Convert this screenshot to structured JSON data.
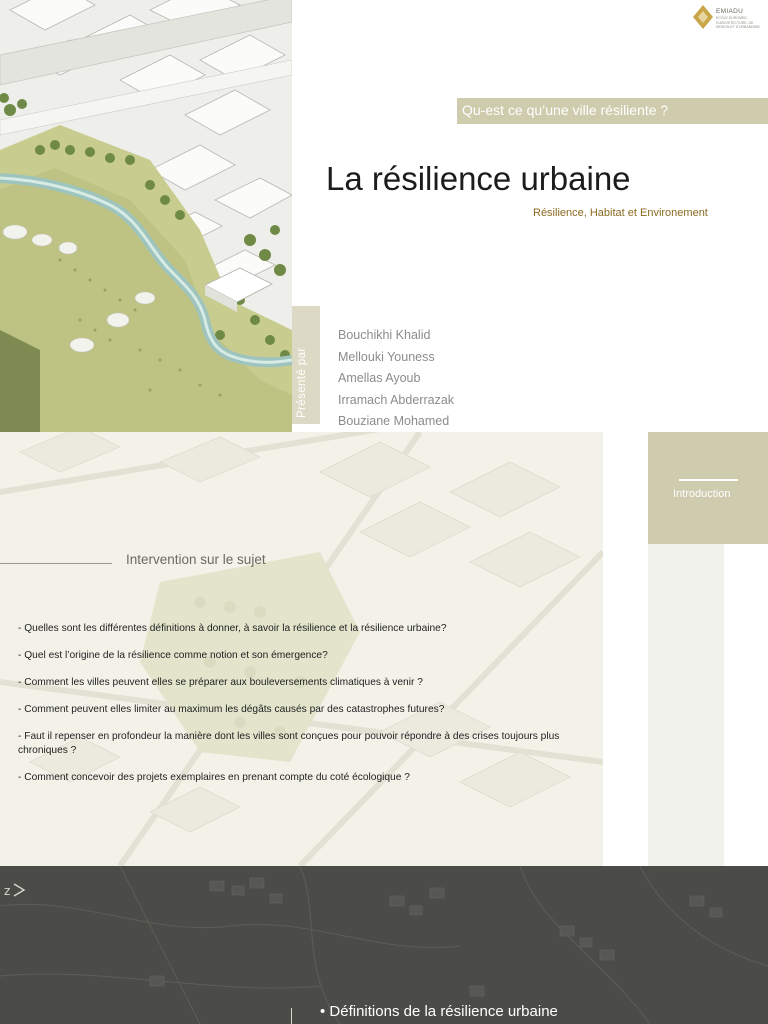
{
  "logo": {
    "name": "EMIADU",
    "subtitle": "ECOLE EUROMED D'ARCHITECTURE, DE DESIGN ET D'URBANISME"
  },
  "question_banner": "Qu-est ce qu’une ville résiliente ?",
  "title": "La résilience urbaine",
  "subtitle": "Résilience, Habitat et Environement",
  "presented_by": "Présenté par",
  "authors": [
    "Bouchikhi Khalid",
    "Mellouki Youness",
    "Amellas Ayoub",
    "Irramach Abderrazak",
    "Bouziane Mohamed"
  ],
  "nav": {
    "intro_label": "Introduction"
  },
  "section": {
    "title": "Intervention sur le sujet",
    "questions": [
      "- Quelles sont les différentes définitions à donner, à savoir la résilience et la résilience urbaine?",
      "- Quel est l’origine de la résilience comme notion et son émergence?",
      "- Comment les villes peuvent elles se préparer aux bouleversements climatiques à venir ?",
      "- Comment peuvent elles limiter au maximum les dégâts causés par des catastrophes futures?",
      "- Faut il repenser en profondeur la manière dont les villes sont conçues pour pouvoir répondre à des crises toujours plus chroniques ?",
      "- Comment concevoir des projets exemplaires en prenant compte du coté écologique ?"
    ]
  },
  "bottom": {
    "bullet_title": "•  Définitions de la résilience urbaine"
  },
  "colors": {
    "accent_khaki": "#cfcbad",
    "subtitle_brown": "#8a6a1f",
    "dark_band": "#4b4b47",
    "map_green": "#8fa05a",
    "river": "#9fc4bd"
  },
  "icons": [
    "logo-mark-icon",
    "north-arrow-icon"
  ]
}
